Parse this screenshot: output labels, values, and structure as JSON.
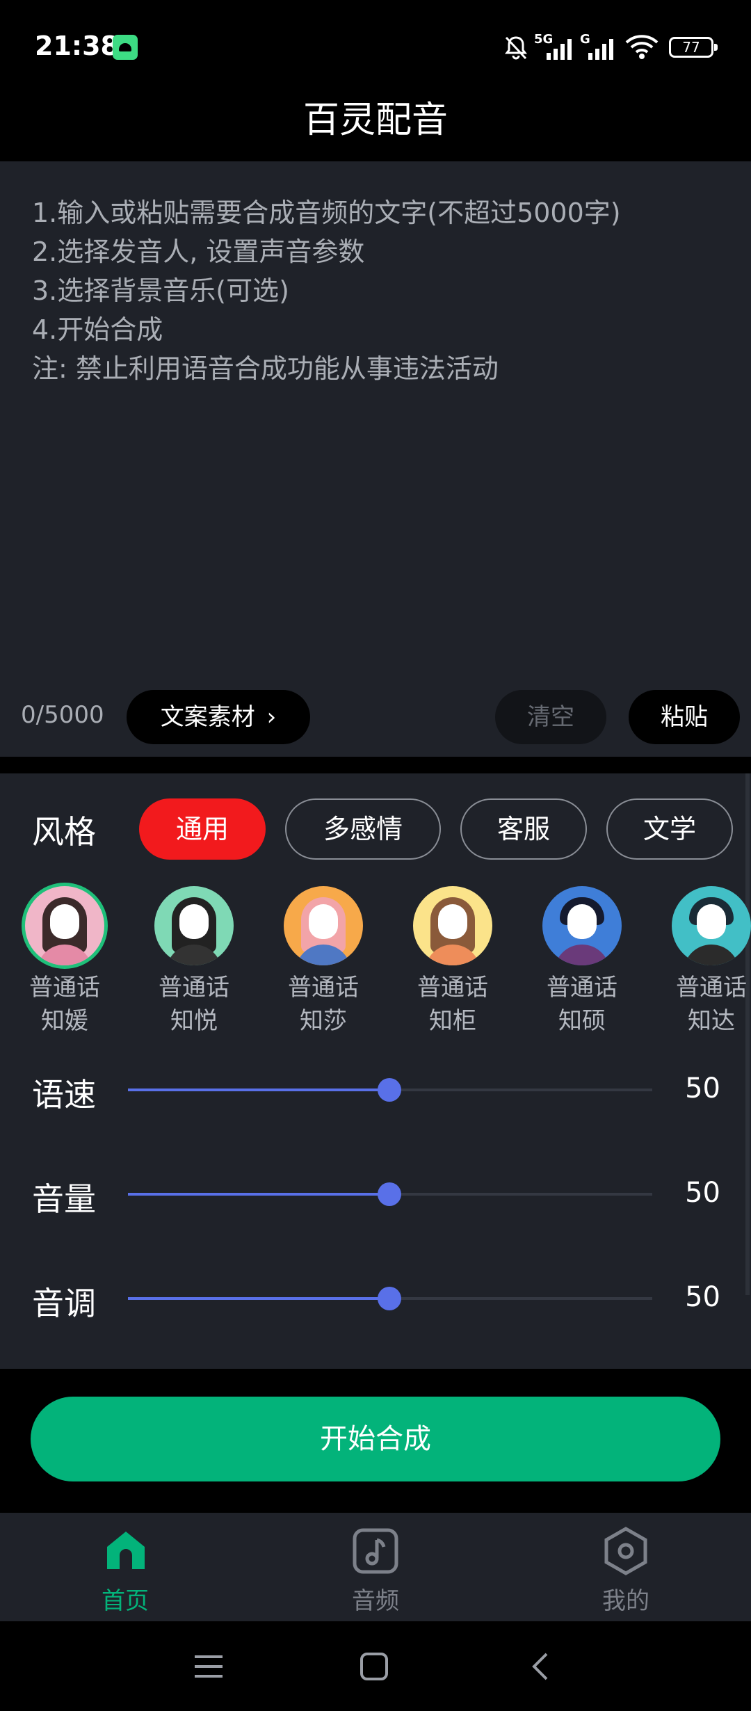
{
  "status_bar": {
    "time": "21:38",
    "network_1": "5G",
    "network_2": "G",
    "battery": "77"
  },
  "header": {
    "title": "百灵配音"
  },
  "editor": {
    "instructions": [
      "1.输入或粘贴需要合成音频的文字(不超过5000字)",
      "2.选择发音人, 设置声音参数",
      "3.选择背景音乐(可选)",
      "4.开始合成",
      "注: 禁止利用语音合成功能从事违法活动"
    ],
    "char_count": "0/5000",
    "material_button": "文案素材",
    "clear_button": "清空",
    "paste_button": "粘贴"
  },
  "style": {
    "label": "风格",
    "chips": [
      "通用",
      "多感情",
      "客服",
      "文学"
    ],
    "active_chip": "通用"
  },
  "voices": [
    {
      "line1": "普通话",
      "line2": "知媛",
      "selected": true
    },
    {
      "line1": "普通话",
      "line2": "知悦",
      "selected": false
    },
    {
      "line1": "普通话",
      "line2": "知莎",
      "selected": false
    },
    {
      "line1": "普通话",
      "line2": "知柜",
      "selected": false
    },
    {
      "line1": "普通话",
      "line2": "知硕",
      "selected": false
    },
    {
      "line1": "普通话",
      "line2": "知达",
      "selected": false
    }
  ],
  "sliders": [
    {
      "label": "语速",
      "value": "50",
      "level": 0.5
    },
    {
      "label": "音量",
      "value": "50",
      "level": 0.5
    },
    {
      "label": "音调",
      "value": "50",
      "level": 0.5
    }
  ],
  "start_button": "开始合成",
  "bottom_nav": [
    {
      "label": "首页",
      "icon": "home-icon",
      "active": true
    },
    {
      "label": "音频",
      "icon": "music-note-icon",
      "active": false
    },
    {
      "label": "我的",
      "icon": "hexagon-settings-icon",
      "active": false
    }
  ],
  "colors": {
    "accent_green": "#03b37a",
    "chip_active_red": "#f21a1d",
    "slider_blue": "#5970e8",
    "panel_bg": "#1f2229"
  }
}
